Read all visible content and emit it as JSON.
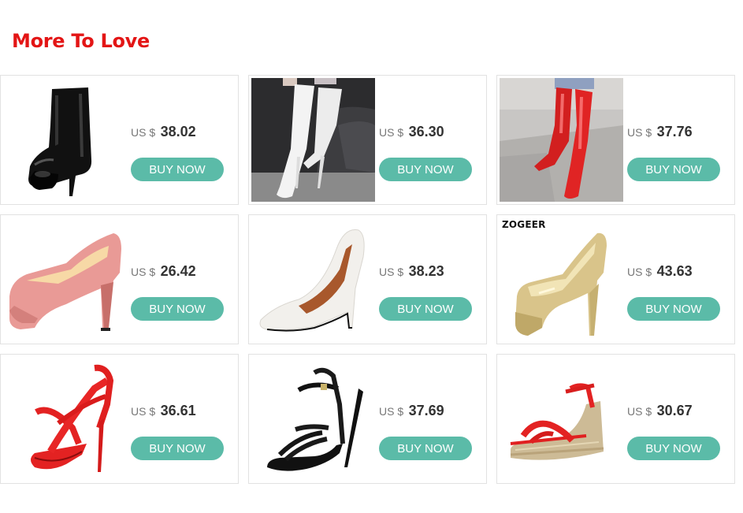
{
  "section": {
    "title": "More To Love"
  },
  "colors": {
    "title": "#e31515",
    "button": "#5bbba8",
    "price": "#333333",
    "currency": "#777777"
  },
  "products": [
    {
      "image_icon": "black-platform-ankle-boot-icon",
      "brand": "",
      "currency": "US $",
      "price": "38.02",
      "button_label": "BUY NOW"
    },
    {
      "image_icon": "white-over-knee-boot-icon",
      "brand": "",
      "currency": "US $",
      "price": "36.30",
      "button_label": "BUY NOW"
    },
    {
      "image_icon": "red-over-knee-boot-icon",
      "brand": "",
      "currency": "US $",
      "price": "37.76",
      "button_label": "BUY NOW"
    },
    {
      "image_icon": "pink-platform-pump-icon",
      "brand": "",
      "currency": "US $",
      "price": "26.42",
      "button_label": "BUY NOW"
    },
    {
      "image_icon": "white-stiletto-pump-icon",
      "brand": "",
      "currency": "US $",
      "price": "38.23",
      "button_label": "BUY NOW"
    },
    {
      "image_icon": "gold-platform-pump-icon",
      "brand": "ZOGEER",
      "currency": "US $",
      "price": "43.63",
      "button_label": "BUY NOW"
    },
    {
      "image_icon": "red-strappy-sandal-icon",
      "brand": "",
      "currency": "US $",
      "price": "36.61",
      "button_label": "BUY NOW"
    },
    {
      "image_icon": "black-strappy-sandal-icon",
      "brand": "",
      "currency": "US $",
      "price": "37.69",
      "button_label": "BUY NOW"
    },
    {
      "image_icon": "red-wedge-sandal-icon",
      "brand": "",
      "currency": "US $",
      "price": "30.67",
      "button_label": "BUY NOW"
    }
  ]
}
